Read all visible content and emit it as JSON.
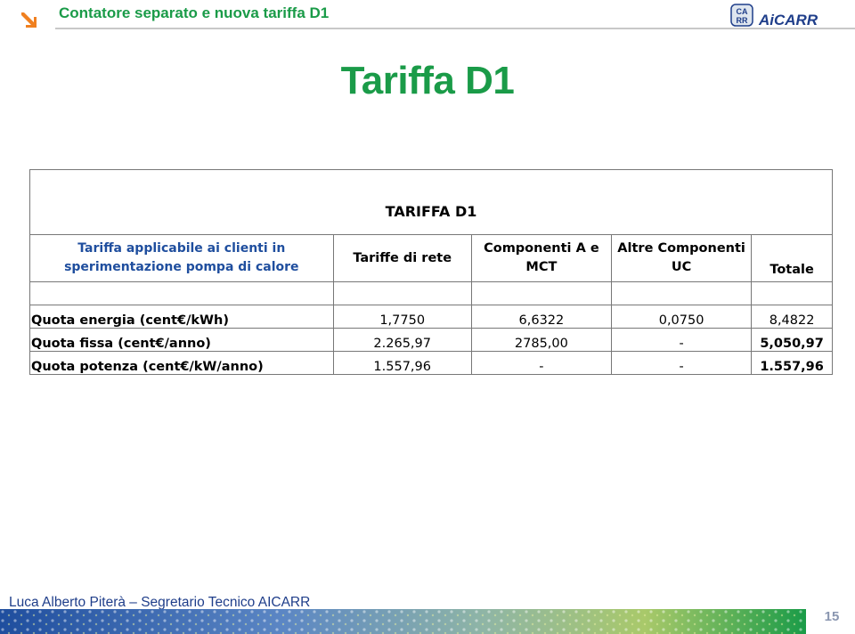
{
  "header": {
    "title": "Contatore separato e nuova tariffa D1",
    "logo_letters": "CA RR",
    "logo_text": "AiCARR",
    "accent_color": "#1a9b48",
    "arrow_color": "#f08020"
  },
  "slide": {
    "title": "Tariffa D1"
  },
  "table": {
    "caption": "TARIFFA D1",
    "headers": {
      "description": "Tariffa applicabile ai clienti in sperimentazione pompa di calore",
      "col1": "Tariffe di rete",
      "col2": "Componenti A e MCT",
      "col3": "Altre Componenti UC",
      "col4": "Totale"
    },
    "rows": [
      {
        "label": "Quota energia (cent€/kWh)",
        "c1": "1,7750",
        "c2": "6,6322",
        "c3": "0,0750",
        "total": "8,4822"
      },
      {
        "label": "Quota fissa (cent€/anno)",
        "c1": "2.265,97",
        "c2": "2785,00",
        "c3": "-",
        "total": "5,050,97"
      },
      {
        "label": "Quota potenza (cent€/kW/anno)",
        "c1": "1.557,96",
        "c2": "-",
        "c3": "-",
        "total": "1.557,96"
      }
    ]
  },
  "footer": {
    "author": "Luca Alberto Piterà – Segretario Tecnico AICARR",
    "page": "15"
  }
}
